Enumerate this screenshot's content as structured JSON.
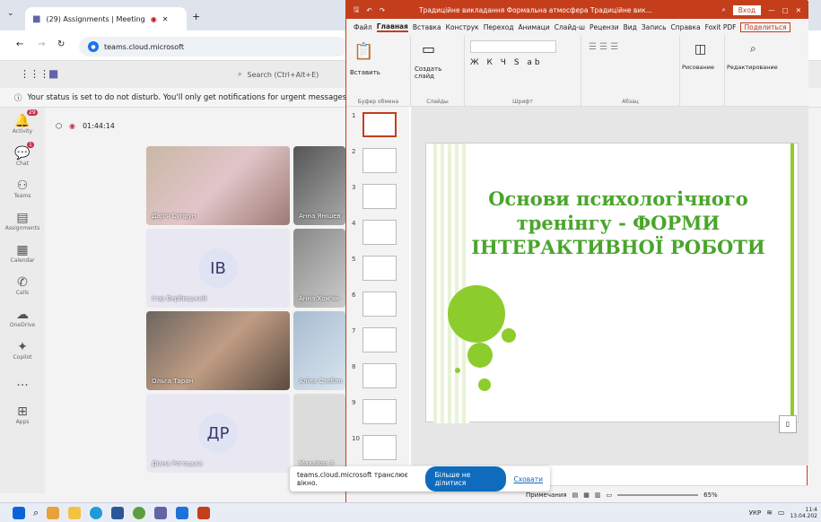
{
  "browser": {
    "tab_title": "(29) Assignments | Meeting",
    "url": "teams.cloud.microsoft"
  },
  "teams": {
    "search_placeholder": "Search (Ctrl+Alt+E)",
    "dnd_text": "Your status is set to do not disturb. You'll only get notifications for urgent messages and",
    "rail": [
      {
        "label": "Activity",
        "badge": "29"
      },
      {
        "label": "Chat",
        "badge": "1"
      },
      {
        "label": "Teams"
      },
      {
        "label": "Assignments"
      },
      {
        "label": "Calendar"
      },
      {
        "label": "Calls"
      },
      {
        "label": "OneDrive"
      },
      {
        "label": "Copilot"
      },
      {
        "label": "..."
      },
      {
        "label": "Apps"
      }
    ],
    "timer": "01:44:14",
    "participants": [
      {
        "name": "Дар'я Супрун"
      },
      {
        "name": "Анна Янішев"
      },
      {
        "name": "Ігор Вербицький",
        "initials": "ІВ"
      },
      {
        "name": "Анна Хом'як"
      },
      {
        "name": "Ольга Таран"
      },
      {
        "name": "Аліна Стебло"
      },
      {
        "name": "Діана Рогоцька",
        "initials": "ДР"
      },
      {
        "name": "Михайло З"
      }
    ]
  },
  "ppt": {
    "title": "Традиційне викладання Формальна атмосфера Традиційне вик...",
    "login": "Вход",
    "menu": [
      "Файл",
      "Главная",
      "Вставка",
      "Конструк",
      "Переход",
      "Анимаци",
      "Слайд-ш",
      "Рецензи",
      "Вид",
      "Запись",
      "Справка",
      "Foxit PDF"
    ],
    "share": "Поделиться",
    "groups": [
      "Буфер обмена",
      "Слайды",
      "Шрифт",
      "Абзац",
      "Рисование",
      "Редактирование"
    ],
    "buttons": {
      "paste": "Вставить",
      "new_slide": "Создать слайд",
      "draw": "Рисование",
      "edit": "Редактирование"
    },
    "slide_numbers": [
      "1",
      "2",
      "3",
      "4",
      "5",
      "6",
      "7",
      "8",
      "9",
      "10"
    ],
    "slide_title": "Основи психологічного тренінгу - ФОРМИ ІНТЕРАКТИВНОЇ РОБОТИ",
    "notes": "Примечания",
    "zoom": "65%"
  },
  "share_bar": {
    "text": "teams.cloud.microsoft транслює вікно.",
    "stop": "Більше не ділитися",
    "hide": "Сховати"
  },
  "taskbar": {
    "lang": "УКР",
    "time": "11:4",
    "date": "13.04.202"
  }
}
